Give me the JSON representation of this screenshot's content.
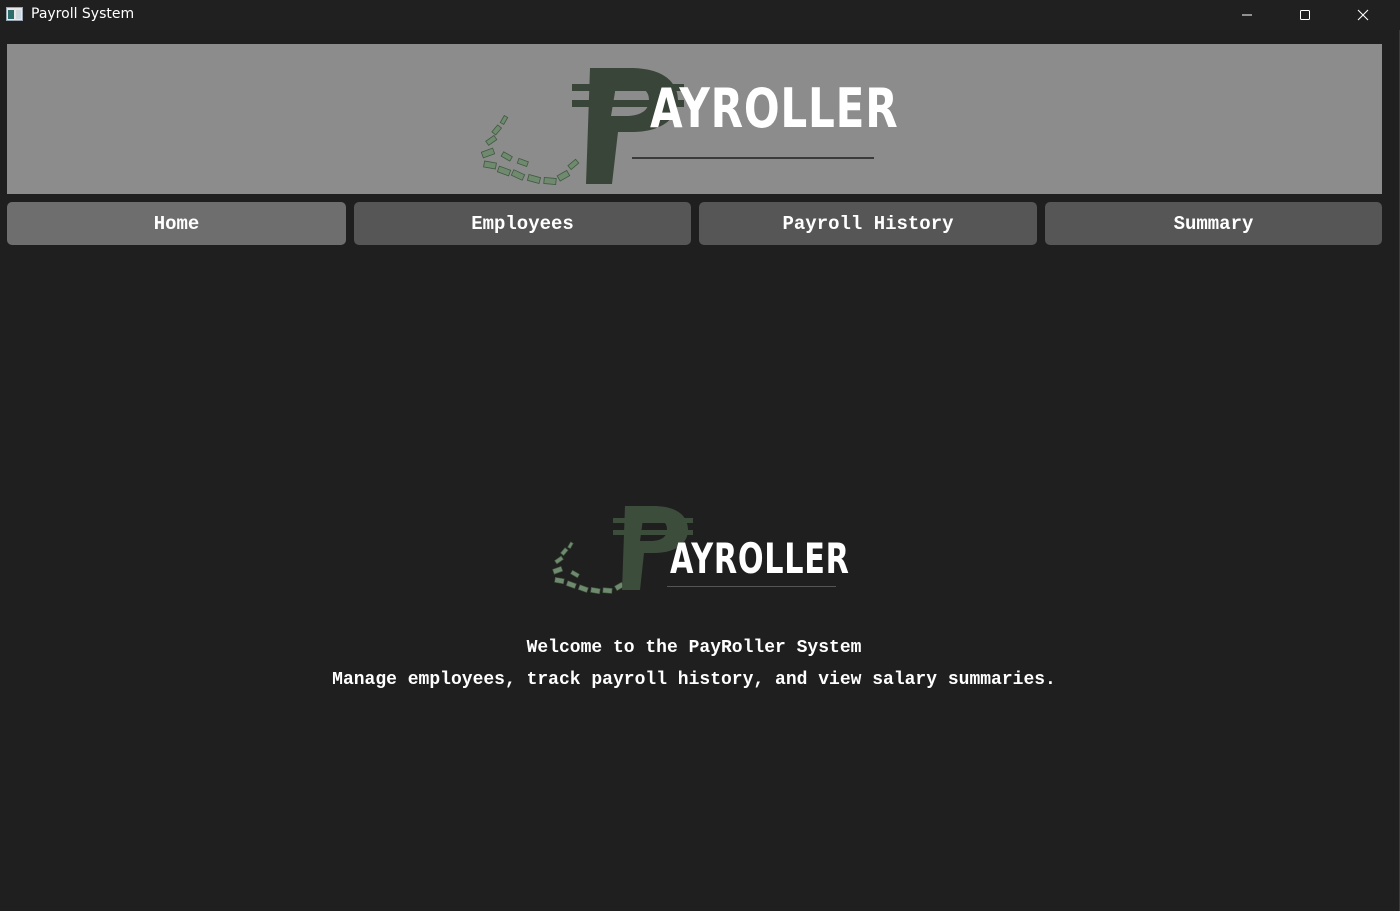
{
  "window": {
    "title": "Payroll System"
  },
  "banner": {
    "logo_text": "AYROLLER",
    "logo_glyph": "₱"
  },
  "nav": {
    "items": [
      {
        "label": "Home",
        "active": true
      },
      {
        "label": "Employees",
        "active": false
      },
      {
        "label": "Payroll History",
        "active": false
      },
      {
        "label": "Summary",
        "active": false
      }
    ]
  },
  "main": {
    "logo_text": "AYROLLER",
    "logo_glyph": "₱",
    "welcome": "Welcome to the PayRoller System",
    "subtitle": "Manage employees, track payroll history, and view salary summaries."
  },
  "colors": {
    "background": "#1f1f1f",
    "banner": "#8c8c8c",
    "button": "#565656",
    "button_active": "#6e6e6e",
    "logo_green": "#3d4a3c",
    "money_green": "#5c7a5c"
  },
  "icons": {
    "app": "app-window-icon",
    "minimize": "minimize-icon",
    "maximize": "maximize-icon",
    "close": "close-icon"
  }
}
